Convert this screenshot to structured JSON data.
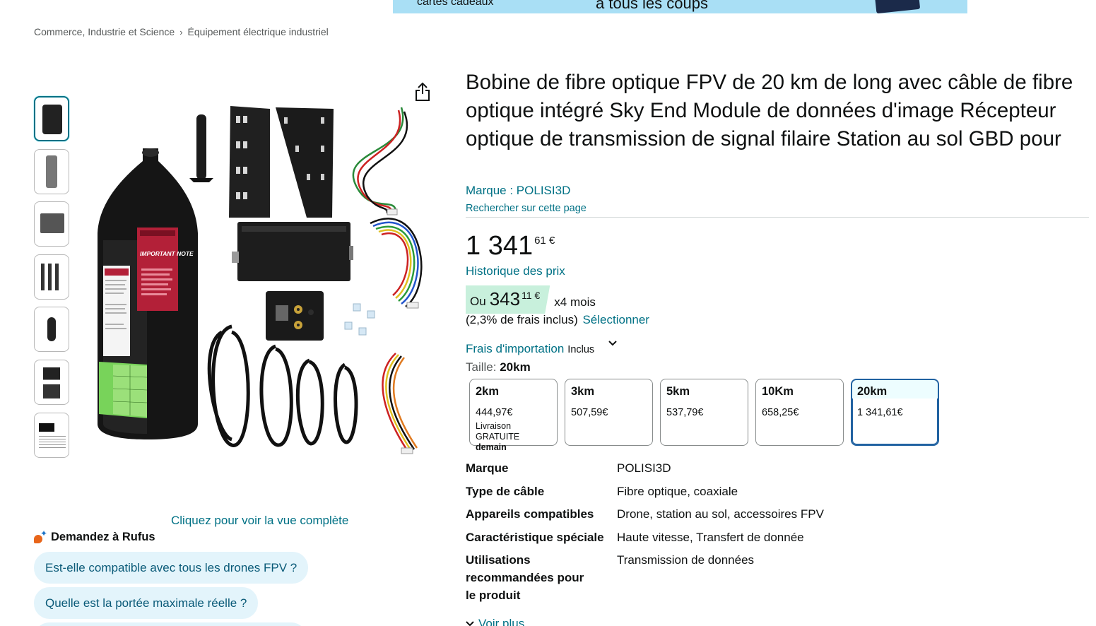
{
  "banner": {
    "left_text": "cartes cadeaux",
    "mid_text": "à tous les coups"
  },
  "breadcrumb": {
    "items": [
      "Commerce, Industrie et Science",
      "Équipement électrique industriel"
    ],
    "separator": "›"
  },
  "gallery": {
    "thumbnails": 7,
    "full_view_link": "Cliquez pour voir la vue complète",
    "image_note": {
      "title": "IMPORTANT NOTE",
      "body": "Before using optical fibers, cut the cable ties and remove the four fasten-ing clasps."
    }
  },
  "rufus": {
    "title": "Demandez à Rufus",
    "questions": [
      "Est-elle compatible avec tous les drones FPV ?",
      "Quelle est la portée maximale réelle ?"
    ]
  },
  "product": {
    "title": "Bobine de fibre optique FPV de 20 km de long avec câble de fibre optique intégré Sky End Module de données d'image Récepteur optique de transmission de signal filaire Station au sol GBD pour",
    "brand_link": "Marque : POLISI3D",
    "search_page": "Rechercher sur cette page"
  },
  "price": {
    "whole": "1 341",
    "fraction": "61 €",
    "history_link": "Historique des prix"
  },
  "installment": {
    "prefix": "Ou",
    "whole": "343",
    "fraction": "11 €",
    "term": "x4 mois",
    "fees": "(2,3% de frais inclus)",
    "select_link": "Sélectionner"
  },
  "import_fees": {
    "link": "Frais d'importation",
    "status": "Inclus"
  },
  "size": {
    "label": "Taille:",
    "selected": "20km",
    "options": [
      {
        "name": "2km",
        "price": "444,97€",
        "delivery": "Livraison",
        "delivery2": "GRATUITE",
        "delivery3": "demain"
      },
      {
        "name": "3km",
        "price": "507,59€"
      },
      {
        "name": "5km",
        "price": "537,79€"
      },
      {
        "name": "10Km",
        "price": "658,25€"
      },
      {
        "name": "20km",
        "price": "1 341,61€"
      }
    ]
  },
  "specs": [
    {
      "key": "Marque",
      "value": "POLISI3D"
    },
    {
      "key": "Type de câble",
      "value": "Fibre optique, coaxiale"
    },
    {
      "key": "Appareils compatibles",
      "value": "Drone, station au sol, accessoires FPV"
    },
    {
      "key": "Caractéristique spéciale",
      "value": "Haute vitesse, Transfert de donnée"
    },
    {
      "key": "Utilisations recommandées pour le produit",
      "value": "Transmission de données"
    }
  ],
  "see_more": "Voir plus",
  "colors": {
    "link": "#007185",
    "selected_border": "#2162a1",
    "installment_bg": "#c8f0dc",
    "rufus_bg": "#e3f4fb",
    "banner_bg": "#a9dff5"
  }
}
